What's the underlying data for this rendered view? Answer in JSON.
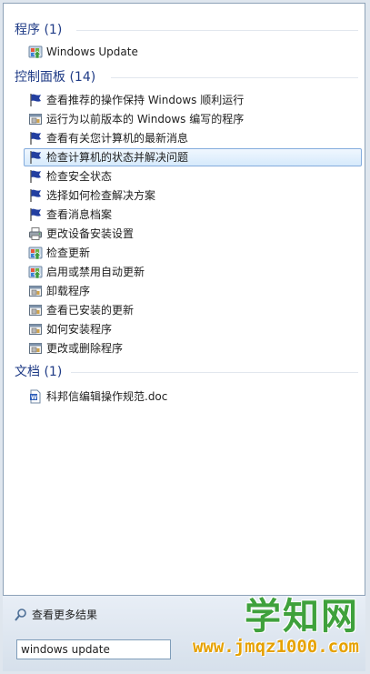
{
  "sections": {
    "programs": {
      "title": "程序 (1)"
    },
    "control_panel": {
      "title": "控制面板 (14)"
    },
    "documents": {
      "title": "文档 (1)"
    }
  },
  "programs": [
    {
      "label": "Windows Update",
      "icon": "windows-update-icon"
    }
  ],
  "control_panel_items": [
    {
      "label": "查看推荐的操作保持 Windows 顺利运行",
      "icon": "action-center-flag-icon"
    },
    {
      "label": "运行为以前版本的 Windows 编写的程序",
      "icon": "program-window-icon"
    },
    {
      "label": "查看有关您计算机的最新消息",
      "icon": "action-center-flag-icon"
    },
    {
      "label": "检查计算机的状态并解决问题",
      "icon": "action-center-flag-icon",
      "selected": true
    },
    {
      "label": "检查安全状态",
      "icon": "action-center-flag-icon"
    },
    {
      "label": "选择如何检查解决方案",
      "icon": "action-center-flag-icon"
    },
    {
      "label": "查看消息档案",
      "icon": "action-center-flag-icon"
    },
    {
      "label": "更改设备安装设置",
      "icon": "device-printer-icon"
    },
    {
      "label": "检查更新",
      "icon": "windows-update-icon"
    },
    {
      "label": "启用或禁用自动更新",
      "icon": "windows-update-icon"
    },
    {
      "label": "卸载程序",
      "icon": "program-window-icon"
    },
    {
      "label": "查看已安装的更新",
      "icon": "program-window-icon"
    },
    {
      "label": "如何安装程序",
      "icon": "program-window-icon"
    },
    {
      "label": "更改或删除程序",
      "icon": "program-window-icon"
    }
  ],
  "documents": [
    {
      "label": "科邦信编辑操作规范.doc",
      "icon": "word-document-icon"
    }
  ],
  "footer": {
    "see_more": "查看更多结果",
    "search_value": "windows update"
  },
  "watermark": {
    "text": "学知网",
    "url": "www.jmqz1000.com"
  },
  "colors": {
    "section_title": "#1f3b86",
    "selection_border": "#84acdd",
    "flag_blue": "#233fa0"
  }
}
